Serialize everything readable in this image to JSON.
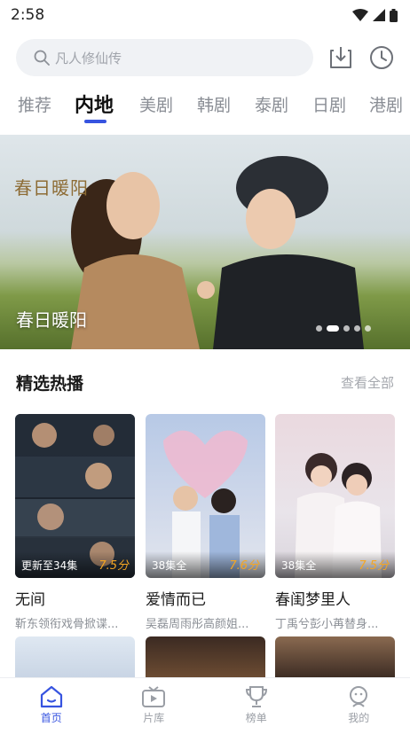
{
  "status_bar": {
    "time": "2:58"
  },
  "search": {
    "placeholder": "凡人修仙传"
  },
  "tabs": [
    {
      "label": "推荐",
      "active": false
    },
    {
      "label": "内地",
      "active": true
    },
    {
      "label": "美剧",
      "active": false
    },
    {
      "label": "韩剧",
      "active": false
    },
    {
      "label": "泰剧",
      "active": false
    },
    {
      "label": "日剧",
      "active": false
    },
    {
      "label": "港剧",
      "active": false
    }
  ],
  "banner": {
    "art_title": "春日暖阳",
    "caption": "春日暖阳",
    "dots_total": 5,
    "active_dot": 1
  },
  "section": {
    "title": "精选热播",
    "more": "查看全部"
  },
  "cards": [
    {
      "badge": "更新至34集",
      "score": "7.5分",
      "title": "无间",
      "subtitle": "靳东领衔戏骨掀谍..."
    },
    {
      "badge": "38集全",
      "score": "7.6分",
      "title": "爱情而已",
      "subtitle": "吴磊周雨彤高颜姐..."
    },
    {
      "badge": "38集全",
      "score": "7.5分",
      "title": "春闺梦里人",
      "subtitle": "丁禹兮彭小苒替身..."
    }
  ],
  "bottom_nav": [
    {
      "label": "首页",
      "icon": "home-icon",
      "active": true
    },
    {
      "label": "片库",
      "icon": "tv-icon",
      "active": false
    },
    {
      "label": "榜单",
      "icon": "trophy-icon",
      "active": false
    },
    {
      "label": "我的",
      "icon": "profile-icon",
      "active": false
    }
  ],
  "colors": {
    "accent": "#3754e0",
    "score": "#f5a623"
  }
}
